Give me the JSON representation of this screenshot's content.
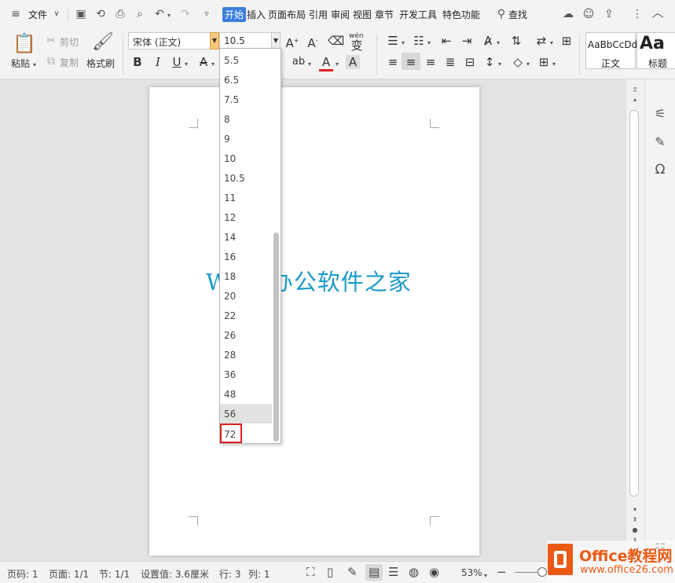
{
  "menu": {
    "file_label": "文件",
    "tabs": [
      "开始",
      "插入",
      "页面布局",
      "引用",
      "审阅",
      "视图",
      "章节",
      "开发工具",
      "特色功能"
    ],
    "search_label": "查找"
  },
  "ribbon": {
    "paste_label": "粘贴",
    "cut_label": "剪切",
    "copy_label": "复制",
    "format_painter_label": "格式刷",
    "font_name": "宋体 (正文)",
    "font_size": "10.5",
    "phonetic_glyph": "wén",
    "style_preview_text": "AaBbCcDd",
    "style_normal_label": "正文",
    "style_heading_preview": "Aa",
    "style_heading_label": "标题"
  },
  "font_size_options": [
    "5.5",
    "6.5",
    "7.5",
    "8",
    "9",
    "10",
    "10.5",
    "11",
    "12",
    "14",
    "16",
    "18",
    "20",
    "22",
    "26",
    "28",
    "36",
    "48",
    "56",
    "72"
  ],
  "hovered_option": "56",
  "highlighted_option": "72",
  "document": {
    "body_text": "Word办公软件之家"
  },
  "status": {
    "page_no": "页码: 1",
    "page_of": "页面: 1/1",
    "section": "节: 1/1",
    "setting": "设置值: 3.6厘米",
    "row": "行: 3",
    "col": "列: 1",
    "zoom": "53%"
  },
  "watermark": {
    "title": "Office教程网",
    "url": "www.office26.com"
  },
  "colors": {
    "accent": "#3d7edb",
    "document_text": "#1d9bc9",
    "highlight_border": "#e02020",
    "watermark": "#ea5a14"
  }
}
